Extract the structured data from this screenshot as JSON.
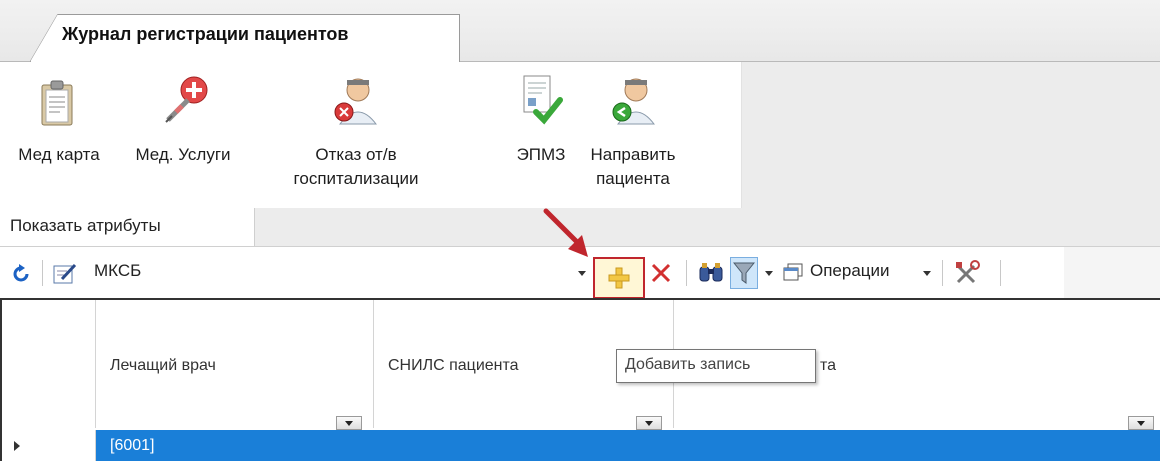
{
  "tab": {
    "title": "Журнал регистрации пациентов"
  },
  "ribbon": {
    "buttons": [
      {
        "label": "Мед карта",
        "icon": "clipboard-icon"
      },
      {
        "label": "Мед. Услуги",
        "icon": "syringe-icon"
      },
      {
        "label_line1": "Отказ от/в",
        "label_line2": "госпитализации",
        "icon": "doctor-cancel-icon"
      },
      {
        "label": "ЭПМЗ",
        "icon": "document-check-icon"
      },
      {
        "label_line1": "Направить",
        "label_line2": "пациента",
        "icon": "doctor-forward-icon"
      }
    ]
  },
  "attributes": {
    "label": "Показать атрибуты"
  },
  "toolbar": {
    "selector_value": "МКСБ",
    "operations_label": "Операции",
    "add_tooltip": "Добавить запись"
  },
  "grid": {
    "columns": [
      {
        "header": "Лечащий врач"
      },
      {
        "header": "СНИЛС пациента"
      },
      {
        "header": "та"
      }
    ],
    "rows": [
      {
        "group": "[6001]"
      }
    ]
  },
  "colors": {
    "selection": "#1a7fd8",
    "highlight_border": "#c0262d",
    "arrow": "#c0262d"
  }
}
